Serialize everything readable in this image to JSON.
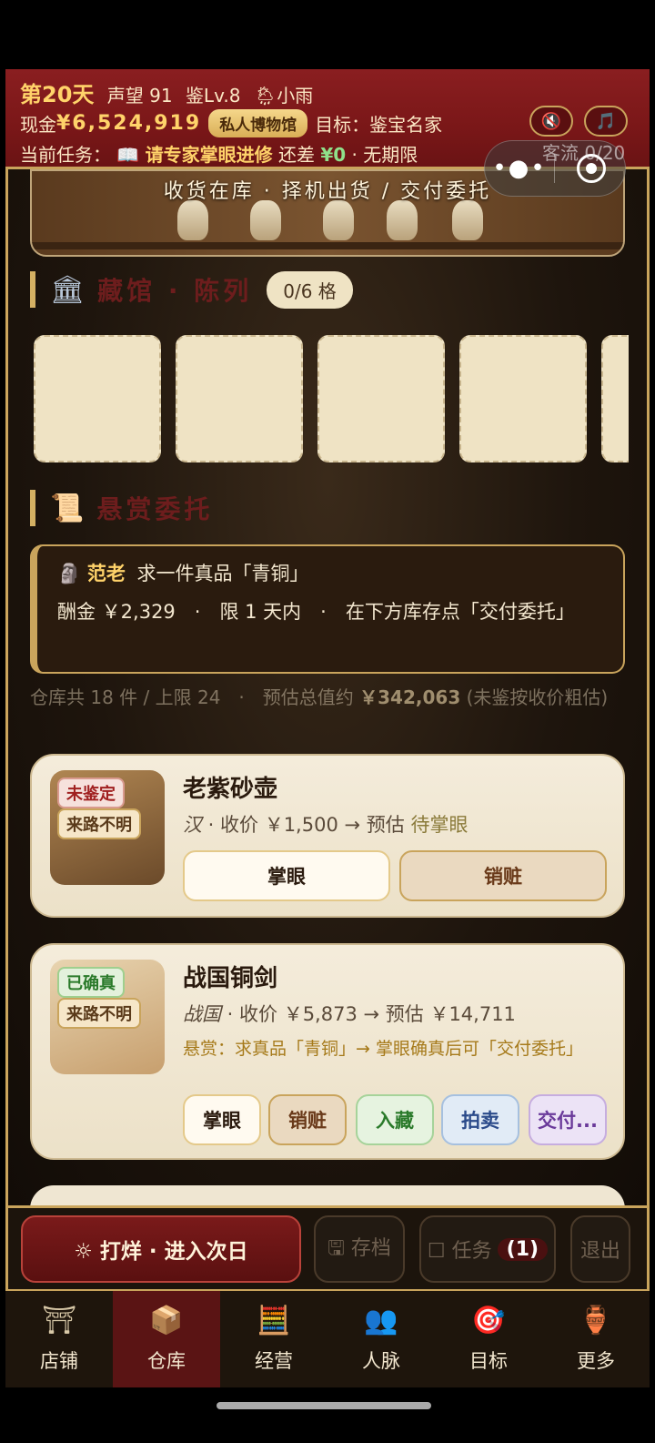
{
  "header": {
    "day": "第20天",
    "reputation": "声望 91",
    "appraise_level": "鉴Lv.8",
    "weather": "🌦小雨",
    "cash_label": "现金",
    "cash_value": "¥6,524,919",
    "museum_badge": "私人博物馆",
    "goal": "目标：鉴宝名家",
    "task_label": "当前任务：",
    "task_icon": "📖",
    "task_name": "请专家掌眼进修",
    "task_remaining_label": "还差",
    "task_remaining_value": "¥0",
    "task_deadline": "· 无期限",
    "guest_flow": "客流 0/20",
    "mute_icon": "🔇",
    "music_icon": "🎵"
  },
  "banner": {
    "text": "收货在库 · 择机出货 / 交付委托"
  },
  "collection": {
    "title": "藏馆 · 陈列",
    "count": "0/6 格",
    "icon": "🏛"
  },
  "bounty_section": {
    "title": "悬赏委托",
    "icon": "📜"
  },
  "bounty": {
    "icon": "🗿",
    "who": "范老",
    "request": "求一件真品「青铜」",
    "details": "酬金 ￥2,329　·　限 1 天内　·　在下方库存点「交付委托」"
  },
  "summary": {
    "text_a": "仓库共 18 件 / 上限 24　·　预估总值约",
    "value": "￥342,063",
    "text_b": "(未鉴按收价粗估)"
  },
  "items": [
    {
      "name": "老紫砂壶",
      "tag1": "未鉴定",
      "tag2": "来路不明",
      "era": "汉",
      "price_text": " · 收价 ￥1,500 → 预估 ",
      "estimate": "待掌眼",
      "buttons": [
        "掌眼",
        "销赃"
      ]
    },
    {
      "name": "战国铜剑",
      "tag1": "已确真",
      "tag2": "来路不明",
      "era": "战国",
      "price_text": " · 收价 ￥5,873 → 预估 ￥14,711",
      "bounty_note": "悬赏：求真品「青铜」→ 掌眼确真后可「交付委托」",
      "buttons": [
        "掌眼",
        "销赃",
        "入藏",
        "拍卖",
        "交付..."
      ]
    }
  ],
  "actions": {
    "next_day": "☼ 打烊 · 进入次日",
    "save": "🖫 存档",
    "tasks": "☐ 任务",
    "tasks_badge": "(1)",
    "exit": "退出"
  },
  "tabs": [
    {
      "icon": "⛩",
      "label": "店铺"
    },
    {
      "icon": "📦",
      "label": "仓库"
    },
    {
      "icon": "🧮",
      "label": "经营"
    },
    {
      "icon": "👥",
      "label": "人脉"
    },
    {
      "icon": "🎯",
      "label": "目标"
    },
    {
      "icon": "🏺",
      "label": "更多"
    }
  ],
  "active_tab": "仓库"
}
